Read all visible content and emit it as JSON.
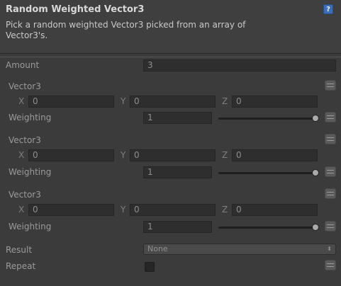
{
  "header": {
    "title": "Random Weighted Vector3",
    "description": "Pick a random weighted Vector3 picked from an array of\nVector3's.",
    "help_icon": "?"
  },
  "amount": {
    "label": "Amount",
    "value": "3"
  },
  "items": [
    {
      "label": "Vector3",
      "x_label": "X",
      "x": "0",
      "y_label": "Y",
      "y": "0",
      "z_label": "Z",
      "z": "0",
      "weight_label": "Weighting",
      "weight": "1",
      "slider_fraction": 1.0
    },
    {
      "label": "Vector3",
      "x_label": "X",
      "x": "0",
      "y_label": "Y",
      "y": "0",
      "z_label": "Z",
      "z": "0",
      "weight_label": "Weighting",
      "weight": "1",
      "slider_fraction": 1.0
    },
    {
      "label": "Vector3",
      "x_label": "X",
      "x": "0",
      "y_label": "Y",
      "y": "0",
      "z_label": "Z",
      "z": "0",
      "weight_label": "Weighting",
      "weight": "1",
      "slider_fraction": 1.0
    }
  ],
  "result": {
    "label": "Result",
    "value": "None",
    "arrows": "⬍"
  },
  "repeat": {
    "label": "Repeat",
    "checked": false
  },
  "colors": {
    "accent": "#3d6db4",
    "background": "#3b3b3b",
    "field": "#2e2e2e"
  }
}
